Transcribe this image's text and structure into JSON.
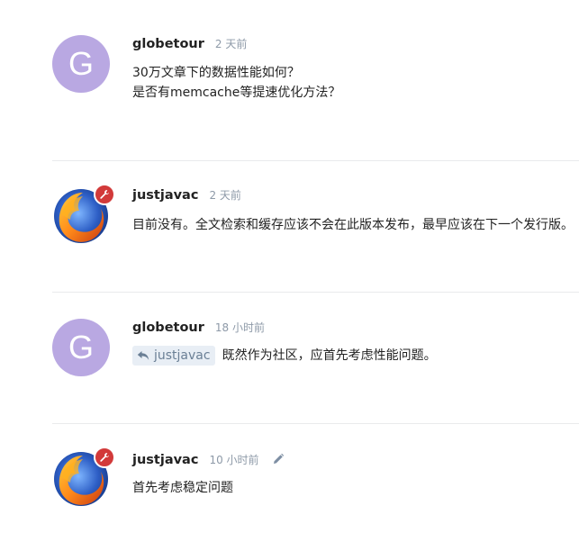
{
  "posts": [
    {
      "username": "globetour",
      "time": "2 天前",
      "avatar_letter": "G",
      "lines": [
        "30万文章下的数据性能如何？",
        "是否有memcache等提速优化方法？"
      ]
    },
    {
      "username": "justjavac",
      "time": "2 天前",
      "lines": [
        "目前没有。全文检索和缓存应该不会在此版本发布，最早应该在下一个发行版。"
      ]
    },
    {
      "username": "globetour",
      "time": "18 小时前",
      "avatar_letter": "G",
      "reply_to": "justjavac",
      "lines": [
        "既然作为社区，应首先考虑性能问题。"
      ]
    },
    {
      "username": "justjavac",
      "time": "10 小时前",
      "lines": [
        "首先考虑稳定问题"
      ]
    }
  ],
  "icons": {
    "badge": "wrench-icon",
    "reply": "reply-arrow-icon",
    "edited": "pencil-icon"
  },
  "colors": {
    "letter_avatar_bg": "#b9a8e2",
    "badge_bg": "#d23a3a",
    "time_text": "#8e9aa8",
    "divider": "#e9eaec"
  }
}
